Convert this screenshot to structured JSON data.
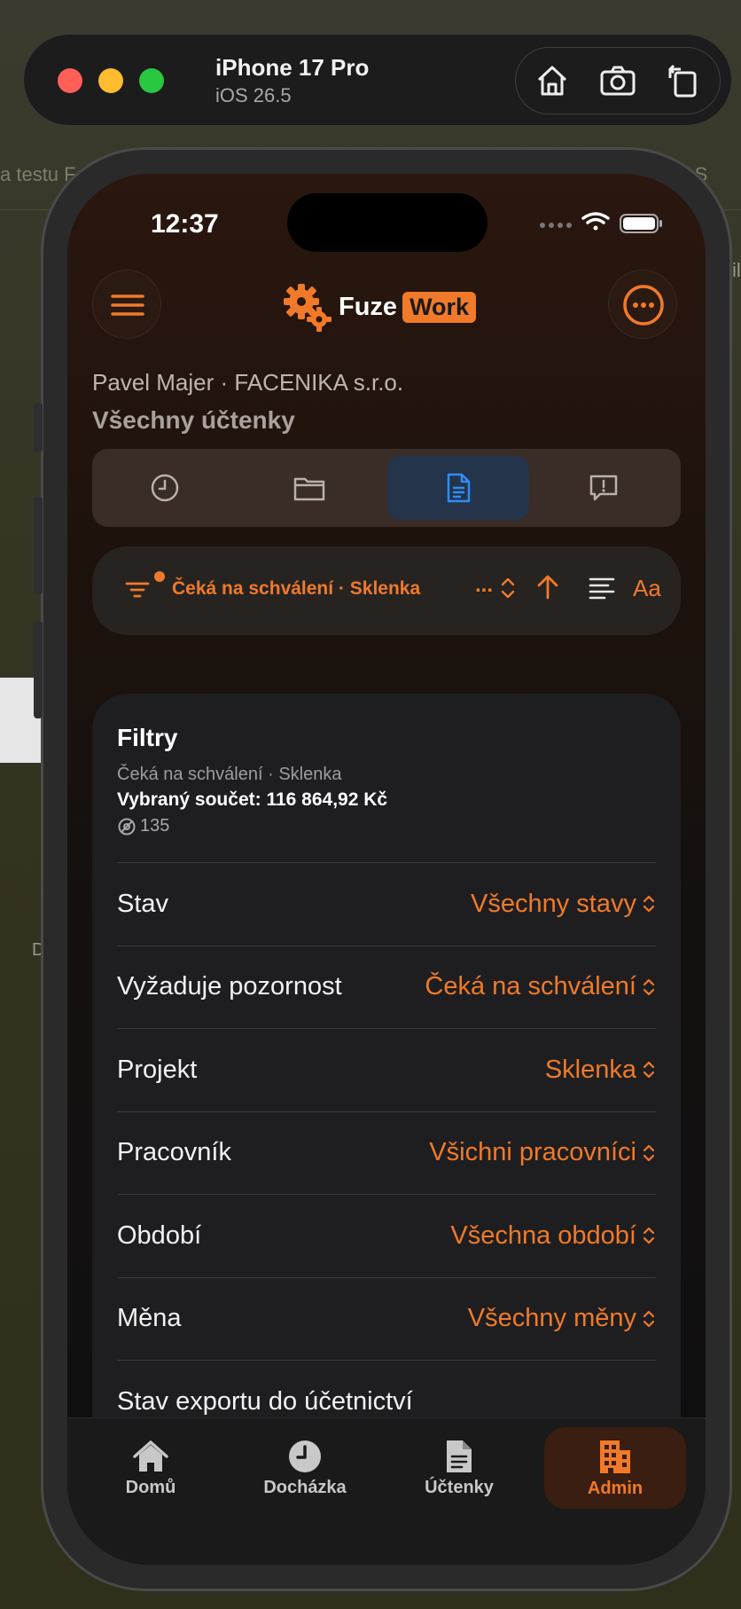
{
  "simulator": {
    "device_name": "iPhone 17 Pro",
    "os_version": "iOS 26.5",
    "controls": [
      "home-icon",
      "screenshot-icon",
      "rotate-icon"
    ]
  },
  "background": {
    "left_fragment": "a testu F",
    "right_fragment": "T_S",
    "right_glyph": "il",
    "left_letter": "D"
  },
  "status_bar": {
    "time": "12:37"
  },
  "app": {
    "logo_text_1": "Fuze",
    "logo_text_2": "Work",
    "accent_color": "#f07a2a"
  },
  "header": {
    "user_line": "Pavel Majer · FACENIKA s.r.o.",
    "title": "Všechny účtenky"
  },
  "segments": [
    "clock-icon",
    "folder-icon",
    "document-icon",
    "feedback-icon"
  ],
  "segments_active": 2,
  "filter_bar": {
    "summary": "Čeká na schválení · Sklenka",
    "ellipsis": "...",
    "font_button": "Aa"
  },
  "filters_card": {
    "title": "Filtry",
    "subtitle": "Čeká na schválení · Sklenka",
    "sum": "Vybraný součet: 116 864,92 Kč",
    "count": "135",
    "rows": [
      {
        "label": "Stav",
        "value": "Všechny stavy"
      },
      {
        "label": "Vyžaduje pozornost",
        "value": "Čeká na schválení"
      },
      {
        "label": "Projekt",
        "value": "Sklenka"
      },
      {
        "label": "Pracovník",
        "value": "Všichni pracovníci"
      },
      {
        "label": "Období",
        "value": "Všechna období"
      },
      {
        "label": "Měna",
        "value": "Všechny měny"
      },
      {
        "label": "Stav exportu do účetnictví",
        "value": ""
      }
    ]
  },
  "tabbar": {
    "items": [
      {
        "label": "Domů",
        "icon": "house-icon"
      },
      {
        "label": "Docházka",
        "icon": "clock-icon"
      },
      {
        "label": "Účtenky",
        "icon": "receipt-icon"
      },
      {
        "label": "Admin",
        "icon": "building-icon"
      }
    ],
    "active": 3
  }
}
